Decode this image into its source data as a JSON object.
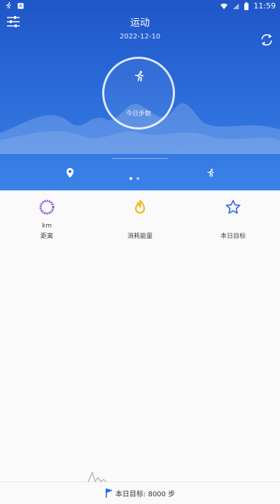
{
  "status_bar": {
    "time": "11:59"
  },
  "header": {
    "title": "运动",
    "date": "2022-12-10",
    "ring_label": "今日步数"
  },
  "stats": [
    {
      "unit": "km",
      "label": "距离"
    },
    {
      "unit": "",
      "label": "消耗能量"
    },
    {
      "unit": "",
      "label": "本日目标"
    }
  ],
  "footer": {
    "goal_text": "本日目标: 8000 步"
  },
  "colors": {
    "header_blue": "#2a6ad8",
    "distance_purple": "#8a4fe0",
    "energy_yellow": "#f2b400",
    "goal_blue": "#3f6fe6",
    "flag_blue": "#1e6be6"
  }
}
